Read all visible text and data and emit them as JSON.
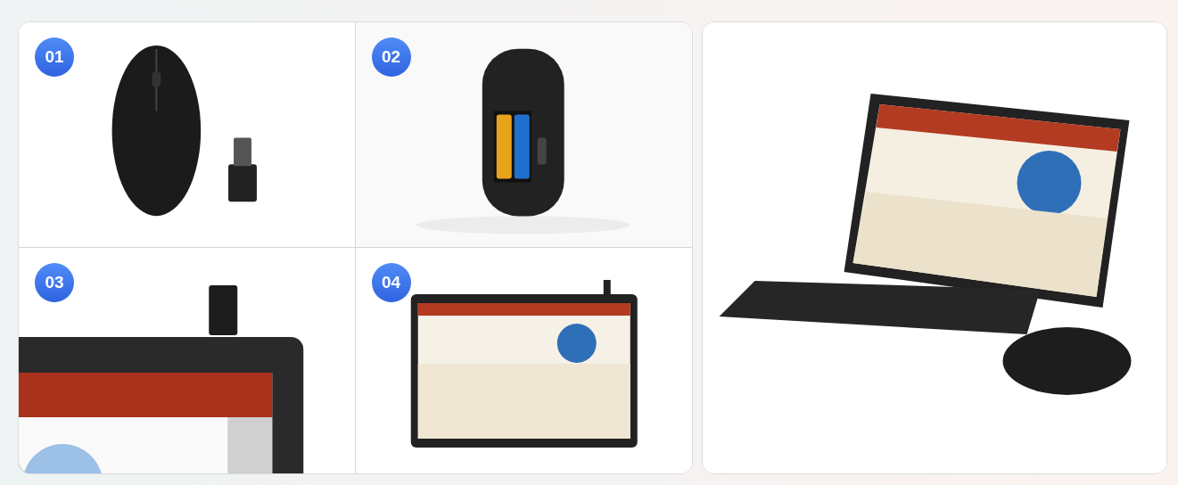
{
  "steps": [
    {
      "badge": "01"
    },
    {
      "badge": "02"
    },
    {
      "badge": "03"
    },
    {
      "badge": "04"
    }
  ]
}
